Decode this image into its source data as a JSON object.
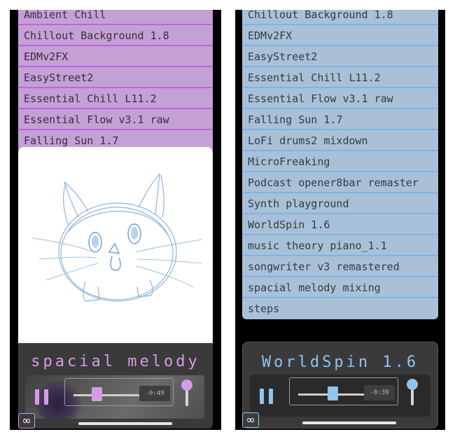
{
  "left_phone": {
    "tracks": [
      "Ambient Chill",
      "Chillout Background 1.8",
      "EDMv2FX",
      "EasyStreet2",
      "Essential Chill L11.2",
      "Essential Flow v3.1 raw",
      "Falling Sun 1.7"
    ],
    "now_playing": "spacial melody",
    "time_remaining": "-0:49",
    "progress": 0.35,
    "volume": 0.9,
    "accent_color": "#d69ae7",
    "loop_icon": "∞"
  },
  "right_phone": {
    "tracks": [
      "Chillout Background 1.8",
      "EDMv2FX",
      "EasyStreet2",
      "Essential Chill L11.2",
      "Essential Flow v3.1 raw",
      "Falling Sun 1.7",
      "LoFi drums2 mixdown",
      "MicroFreaking",
      "Podcast opener8bar remaster",
      "Synth playground",
      "WorldSpin 1.6",
      "music theory piano_1.1",
      "songwriter v3 remastered",
      "spacial melody mixing",
      "steps"
    ],
    "now_playing": "WorldSpin 1.6",
    "time_remaining": "-0:39",
    "progress": 0.52,
    "volume": 0.9,
    "accent_color": "#8fc4ee",
    "loop_icon": "∞"
  }
}
